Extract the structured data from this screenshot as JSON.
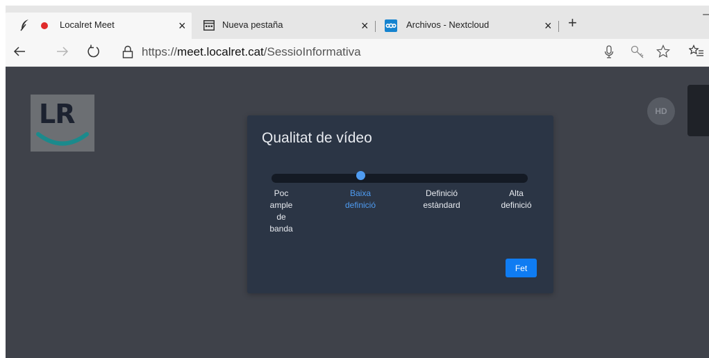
{
  "browser": {
    "tabs": [
      {
        "title": "Localret Meet",
        "icon": "feather-icon",
        "recording": true,
        "active": true
      },
      {
        "title": "Nueva pestaña",
        "icon": "new-tab-page-icon",
        "active": false
      },
      {
        "title": "Archivos - Nextcloud",
        "icon": "nextcloud-icon",
        "active": false
      }
    ],
    "close_symbol": "×",
    "new_tab_symbol": "+",
    "minimize_symbol": "–",
    "address": {
      "protocol": "https://",
      "host": "meet.localret.cat",
      "path": "/SessioInformativa"
    }
  },
  "page": {
    "logo_text": "LR",
    "hd_badge": "HD",
    "dialog": {
      "title": "Qualitat de vídeo",
      "options": [
        {
          "label": "Poc ample de banda",
          "lines": [
            "Poc",
            "ample",
            "de",
            "banda"
          ]
        },
        {
          "label": "Baixa definició",
          "lines": [
            "Baixa",
            "definició"
          ]
        },
        {
          "label": "Definició estàndard",
          "lines": [
            "Definició",
            "estàndard"
          ]
        },
        {
          "label": "Alta definició",
          "lines": [
            "Alta",
            "definició"
          ]
        }
      ],
      "selected_index": 1,
      "done_label": "Fet"
    }
  },
  "colors": {
    "accent": "#4f9cf2",
    "button": "#0f7cf2",
    "page_bg": "#3f424a",
    "dialog_bg": "#2b3545",
    "logo_teal": "#1b8a8c",
    "recording": "#e02b2b",
    "nextcloud": "#1583cf"
  }
}
